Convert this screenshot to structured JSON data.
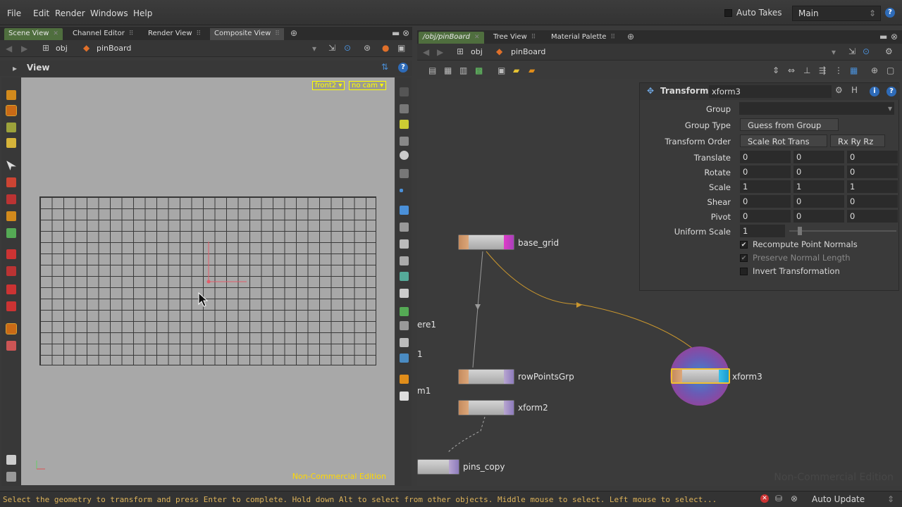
{
  "menu": [
    "File",
    "Edit",
    "Render",
    "Windows",
    "Help"
  ],
  "topright": {
    "auto_takes": "Auto Takes",
    "desktop": "Main"
  },
  "left_tabs": [
    "Scene View",
    "Channel Editor",
    "Render View",
    "Composite View"
  ],
  "left_path": {
    "root": "obj",
    "node": "pinBoard"
  },
  "view": {
    "title": "View",
    "cam1": "front2 ▾",
    "cam2": "no cam ▾",
    "watermark": "Non-Commercial Edition"
  },
  "right_tabs": [
    "/obj/pinBoard",
    "Tree View",
    "Material Palette"
  ],
  "right_path": {
    "root": "obj",
    "node": "pinBoard"
  },
  "nodes": {
    "base_grid": "base_grid",
    "rowPointsGrp": "rowPointsGrp",
    "xform2": "xform2",
    "pins_copy": "pins_copy",
    "xform3": "xform3",
    "partial1": "ere1",
    "partial2": "1",
    "partial3": "m1"
  },
  "params": {
    "op_type": "Transform",
    "op_name": "xform3",
    "rows": {
      "group": "Group",
      "group_type": "Group Type",
      "group_type_val": "Guess from Group",
      "transform_order": "Transform Order",
      "transform_order_val": "Scale Rot Trans",
      "rot_order_val": "Rx Ry Rz",
      "translate": "Translate",
      "rotate": "Rotate",
      "scale": "Scale",
      "shear": "Shear",
      "pivot": "Pivot",
      "uniform_scale": "Uniform Scale"
    },
    "values": {
      "translate": [
        "0",
        "0",
        "0"
      ],
      "rotate": [
        "0",
        "0",
        "0"
      ],
      "scale": [
        "1",
        "1",
        "1"
      ],
      "shear": [
        "0",
        "0",
        "0"
      ],
      "pivot": [
        "0",
        "0",
        "0"
      ],
      "uniform_scale": "1"
    },
    "checks": {
      "recompute": "Recompute Point Normals",
      "preserve": "Preserve Normal Length",
      "invert": "Invert Transformation",
      "check_mark": "✔"
    },
    "network_watermark": "Non-Commercial Edition"
  },
  "status": {
    "message": "Select the geometry to transform and press Enter to complete. Hold down Alt to select from other objects. Middle mouse to select. Left mouse to select...",
    "update_mode": "Auto Update"
  },
  "colors": {
    "accent_tab": "#4f6e3e",
    "status_text": "#ddb35a",
    "watermark": "#ffd800"
  }
}
